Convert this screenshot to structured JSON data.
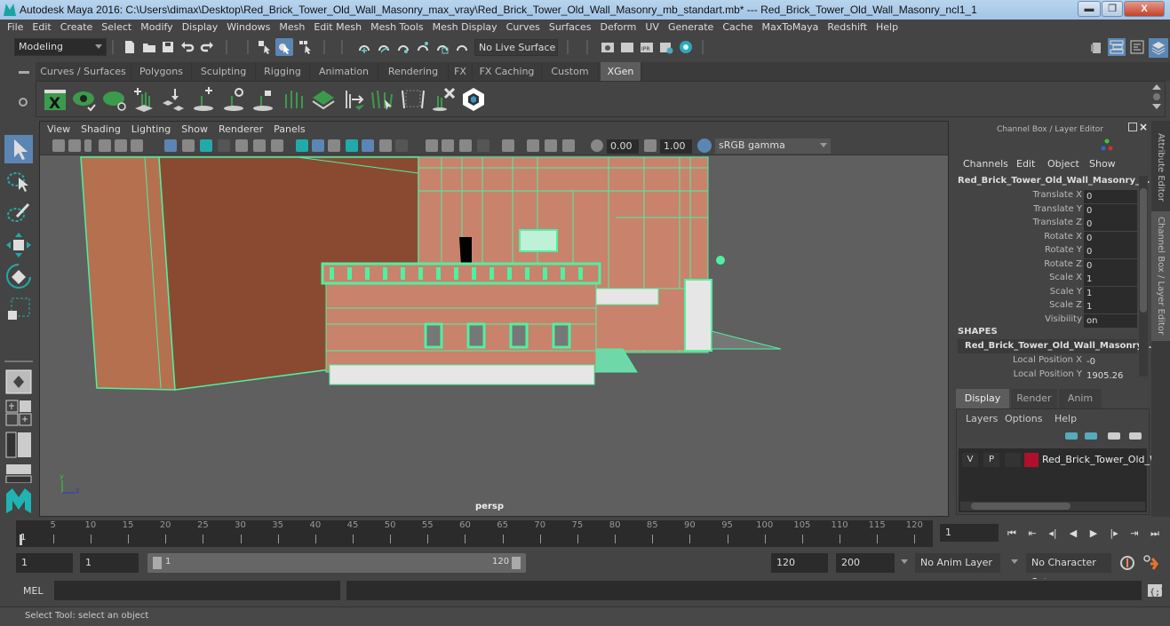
{
  "window": {
    "title": "Autodesk Maya 2016: C:\\Users\\dimax\\Desktop\\Red_Brick_Tower_Old_Wall_Masonry_max_vray\\Red_Brick_Tower_Old_Wall_Masonry_mb_standart.mb*  ---  Red_Brick_Tower_Old_Wall_Masonry_ncl1_1",
    "minimize": "▬",
    "restore": "❐",
    "close": "X"
  },
  "menubar": [
    "File",
    "Edit",
    "Create",
    "Select",
    "Modify",
    "Display",
    "Windows",
    "Mesh",
    "Edit Mesh",
    "Mesh Tools",
    "Mesh Display",
    "Curves",
    "Surfaces",
    "Deform",
    "UV",
    "Generate",
    "Cache",
    "MaxToMaya",
    "Redshift",
    "Help"
  ],
  "statusline": {
    "menuset": "Modeling",
    "live_surface": "No Live Surface",
    "icons": [
      "new-scene-icon",
      "open-scene-icon",
      "save-scene-icon",
      "undo-icon",
      "redo-icon",
      "select-by-hierarchy-icon",
      "select-by-object-icon",
      "select-by-component-icon",
      "snap-grid-icon",
      "snap-curve-icon",
      "snap-point-icon",
      "snap-projected-icon",
      "snap-view-plane-icon",
      "make-live-icon",
      "render-view-icon",
      "render-current-icon",
      "ipr-render-icon",
      "render-settings-icon",
      "hypershade-icon"
    ]
  },
  "shelf": {
    "tabs": [
      {
        "label": "Curves / Surfaces",
        "active": false
      },
      {
        "label": "Polygons",
        "active": false
      },
      {
        "label": "Sculpting",
        "active": false
      },
      {
        "label": "Rigging",
        "active": false
      },
      {
        "label": "Animation",
        "active": false
      },
      {
        "label": "Rendering",
        "active": false
      },
      {
        "label": "FX",
        "active": false
      },
      {
        "label": "FX Caching",
        "active": false
      },
      {
        "label": "Custom",
        "active": false
      },
      {
        "label": "XGen",
        "active": true
      }
    ],
    "icons": [
      "xgen-editor-icon",
      "preview-icon",
      "clear-preview-icon",
      "create-description-icon",
      "place-guides-icon",
      "add-guide-icon",
      "toggle-guide-visibility-icon",
      "lock-guides-icon",
      "guides-to-curves-icon",
      "paint-density-icon",
      "cut-guides-icon",
      "sculpt-guides-icon",
      "guide-interactive-icon",
      "delete-guides-icon",
      "xgen-logo-icon"
    ]
  },
  "toolbox": [
    "select-tool-icon",
    "lasso-tool-icon",
    "paint-select-tool-icon",
    "move-tool-icon",
    "rotate-tool-icon",
    "scale-tool-icon",
    "single-perspective-layout-icon",
    "four-view-layout-icon",
    "persp-outliner-layout-icon",
    "persp-graph-layout-icon",
    "maya-logo-icon"
  ],
  "viewport": {
    "menu": [
      "View",
      "Shading",
      "Lighting",
      "Show",
      "Renderer",
      "Panels"
    ],
    "exposure": "0.00",
    "gamma": "1.00",
    "color_space": "sRGB gamma",
    "camera": "persp",
    "axis": {
      "y": "y",
      "z": "z"
    }
  },
  "channel_box": {
    "title": "Channel Box / Layer Editor",
    "menu": [
      "Channels",
      "Edit",
      "Object",
      "Show"
    ],
    "object_name": "Red_Brick_Tower_Old_Wall_Masonry_...",
    "attributes": [
      {
        "label": "Translate X",
        "value": "0"
      },
      {
        "label": "Translate Y",
        "value": "0"
      },
      {
        "label": "Translate Z",
        "value": "0"
      },
      {
        "label": "Rotate X",
        "value": "0"
      },
      {
        "label": "Rotate Y",
        "value": "0"
      },
      {
        "label": "Rotate Z",
        "value": "0"
      },
      {
        "label": "Scale X",
        "value": "1"
      },
      {
        "label": "Scale Y",
        "value": "1"
      },
      {
        "label": "Scale Z",
        "value": "1"
      },
      {
        "label": "Visibility",
        "value": "on"
      }
    ],
    "shapes_header": "SHAPES",
    "shape_name": "Red_Brick_Tower_Old_Wall_Masonry...",
    "shape_attributes": [
      {
        "label": "Local Position X",
        "value": "-0"
      },
      {
        "label": "Local Position Y",
        "value": "1905.26"
      }
    ]
  },
  "side_tabs": [
    "Attribute Editor",
    "Channel Box / Layer Editor"
  ],
  "layer_editor": {
    "tabs": [
      {
        "label": "Display",
        "active": true
      },
      {
        "label": "Render",
        "active": false
      },
      {
        "label": "Anim",
        "active": false
      }
    ],
    "menu": [
      "Layers",
      "Options",
      "Help"
    ],
    "layers": [
      {
        "v": "V",
        "p": "P",
        "color": "#b0102c",
        "name": "Red_Brick_Tower_Old_W"
      }
    ]
  },
  "time_slider": {
    "start_label": "1",
    "ticks": [
      5,
      10,
      15,
      20,
      25,
      30,
      35,
      40,
      45,
      50,
      55,
      60,
      65,
      70,
      75,
      80,
      85,
      90,
      95,
      100,
      105,
      110,
      115,
      120
    ],
    "current_frame": "1",
    "playback": [
      "⏮",
      "⇤",
      "◂|",
      "◀",
      "▶",
      "|▸",
      "⇥",
      "⏭"
    ]
  },
  "range_slider": {
    "start": "1",
    "anim_start": "1",
    "range_start": "1",
    "range_end": "120",
    "anim_end": "120",
    "end": "200",
    "anim_layer": "No Anim Layer",
    "character_set": "No Character Set"
  },
  "command_line": {
    "label": "MEL",
    "input": "",
    "result": ""
  },
  "help_line": "Select Tool: select an object",
  "colors": {
    "accent": "#5b86b4",
    "wireframe": "#4ff0a0",
    "brick_dark": "#8a4a32",
    "brick_light": "#c9826c",
    "layer": "#b0102c"
  }
}
